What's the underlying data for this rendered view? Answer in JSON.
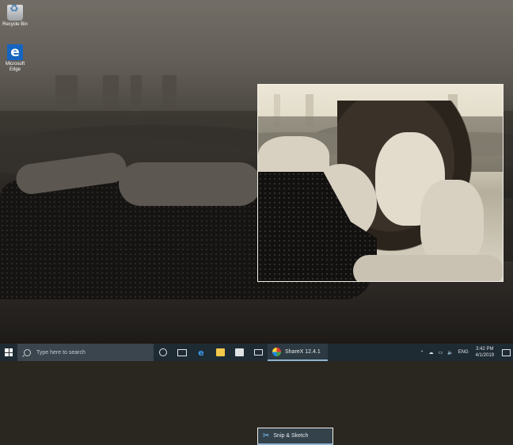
{
  "desktop": {
    "icons": [
      {
        "label": "Recycle Bin",
        "icon": "recycle-bin-icon"
      },
      {
        "label": "Microsoft Edge",
        "icon": "edge-icon"
      }
    ]
  },
  "taskbar": {
    "search_placeholder": "Type here to search",
    "apps": [
      {
        "label": "ShareX 12.4.1",
        "icon": "sharex-icon"
      },
      {
        "label": "Snip & Sketch",
        "icon": "snip-sketch-icon"
      }
    ],
    "tray": {
      "language": "ENG",
      "time": "3:42 PM",
      "date": "4/1/2019"
    }
  },
  "colors": {
    "taskbar_bg": "#1f2b33",
    "selection_border": "#f3f0e8",
    "active_app_underline": "#8fb3d1"
  }
}
